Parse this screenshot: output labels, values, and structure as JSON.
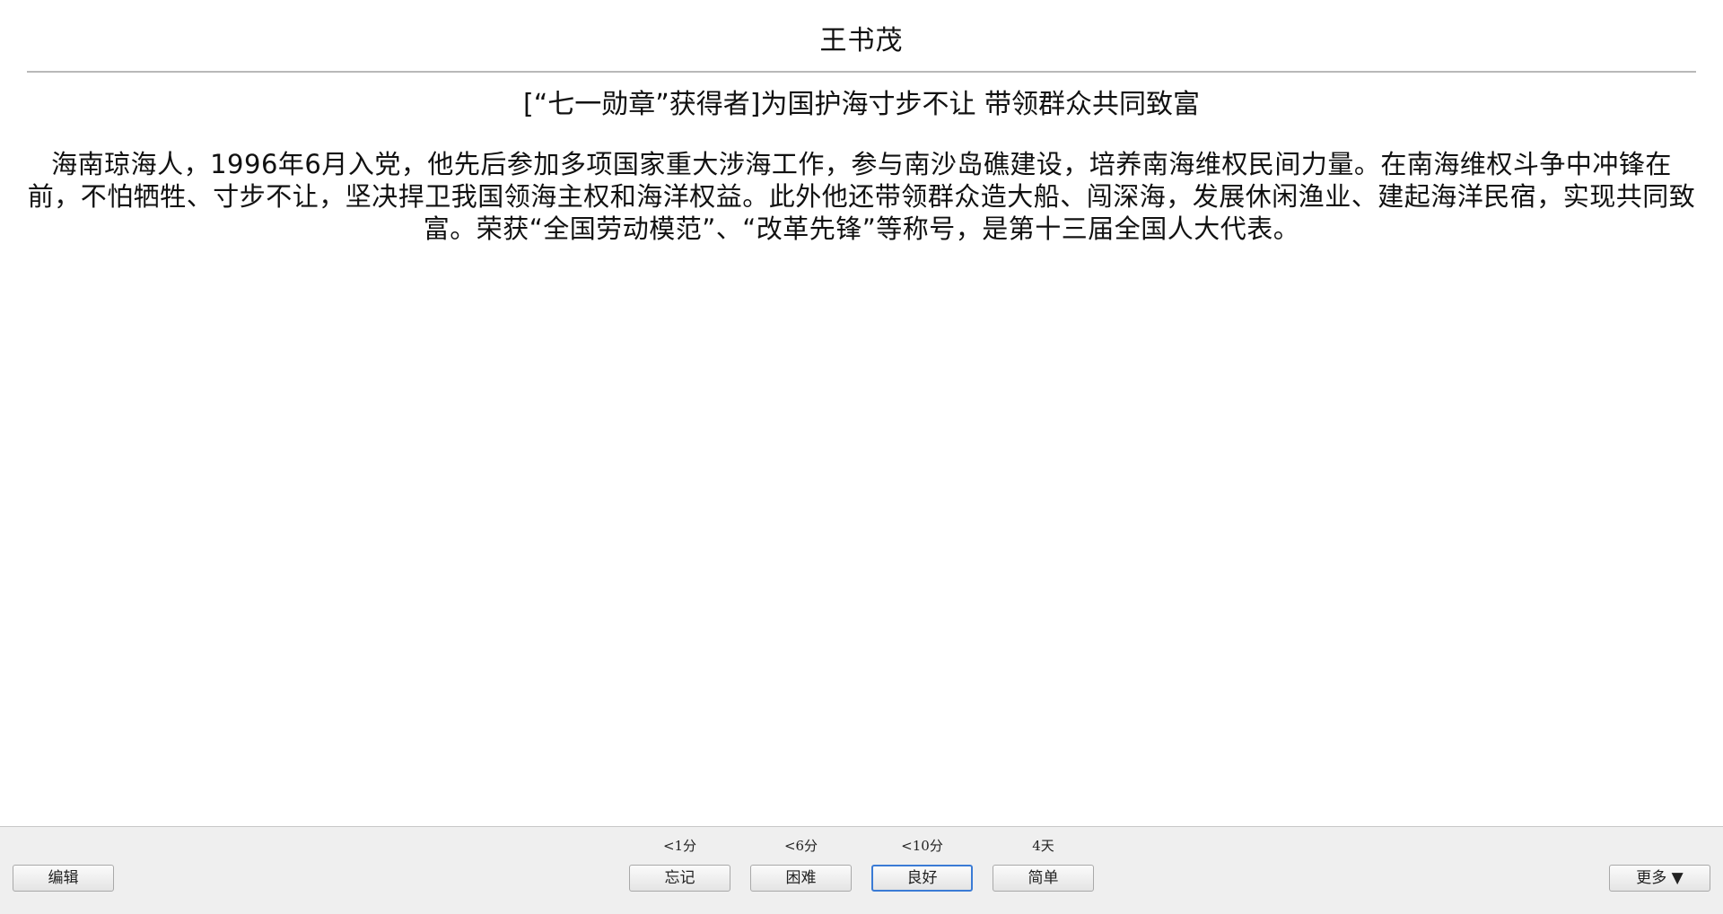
{
  "card": {
    "front": "王书茂",
    "subtitle": "[“七一勋章”获得者]为国护海寸步不让 带领群众共同致富",
    "body": "海南琼海人，1996年6月入党，他先后参加多项国家重大涉海工作，参与南沙岛礁建设，培养南海维权民间力量。在南海维权斗争中冲锋在前，不怕牺牲、寸步不让，坚决捍卫我国领海主权和海洋权益。此外他还带领群众造大船、闯深海，发展休闲渔业、建起海洋民宿，实现共同致富。荣获“全国劳动模范”、“改革先锋”等称号，是第十三届全国人大代表。"
  },
  "bottom_bar": {
    "edit_label": "编辑",
    "more_label": "更多 ▼",
    "answers": [
      {
        "interval": "<1分",
        "label": "忘记"
      },
      {
        "interval": "<6分",
        "label": "困难"
      },
      {
        "interval": "<10分",
        "label": "良好"
      },
      {
        "interval": "4天",
        "label": "简单"
      }
    ]
  },
  "colors": {
    "default_button_border": "#3a7bd5",
    "bar_background": "#efefef"
  }
}
